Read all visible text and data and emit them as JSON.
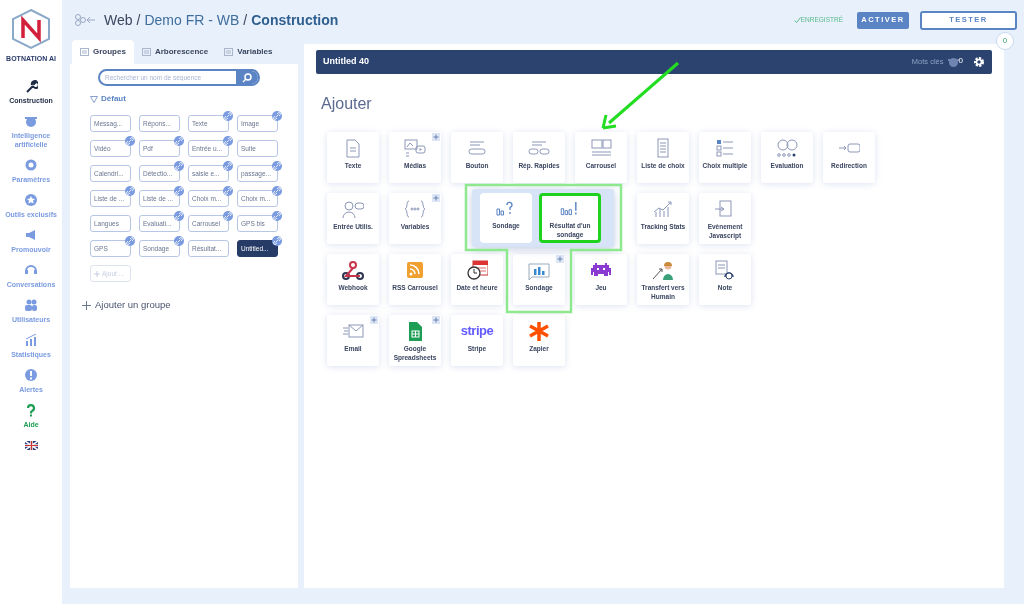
{
  "logo": {
    "text": "BOTNATION AI"
  },
  "nav": [
    {
      "label": "Construction",
      "color": "#1f2a44"
    },
    {
      "label": "Intelligence artificielle",
      "color": "#7b9be0"
    },
    {
      "label": "Paramètres",
      "color": "#7b9be0"
    },
    {
      "label": "Outils exclusifs",
      "color": "#7b9be0"
    },
    {
      "label": "Promouvoir",
      "color": "#7b9be0"
    },
    {
      "label": "Conversations",
      "color": "#7b9be0"
    },
    {
      "label": "Utilisateurs",
      "color": "#7b9be0"
    },
    {
      "label": "Statistiques",
      "color": "#7b9be0"
    },
    {
      "label": "Alertes",
      "color": "#7b9be0"
    },
    {
      "label": "Aide",
      "color": "#1e9e55"
    }
  ],
  "breadcrumb": [
    {
      "text": "Web",
      "kind": "root"
    },
    {
      "text": "/",
      "kind": "sep"
    },
    {
      "text": "Demo FR - WB",
      "kind": "link"
    },
    {
      "text": "/",
      "kind": "sep"
    },
    {
      "text": "Construction",
      "kind": "current"
    }
  ],
  "save_status": "ENREGISTRÉ",
  "buttons": [
    {
      "label": "ACTIVER",
      "kind": "primary"
    },
    {
      "label": "TESTER",
      "kind": "outline"
    }
  ],
  "notification_count": "0",
  "panel": {
    "tabs": [
      {
        "label": "Groupes",
        "selected": true
      },
      {
        "label": "Arborescence",
        "selected": false
      },
      {
        "label": "Variables",
        "selected": false
      }
    ],
    "search": {
      "placeholder": "Rechercher un nom de séquence"
    },
    "group": {
      "name": "Défaut",
      "expanded": true,
      "sequences": [
        {
          "label": "Messag...",
          "linked": false,
          "selected": false
        },
        {
          "label": "Répons...",
          "linked": false,
          "selected": false
        },
        {
          "label": "Texte",
          "linked": true,
          "selected": false
        },
        {
          "label": "Image",
          "linked": true,
          "selected": false
        },
        {
          "label": "Vidéo",
          "linked": true,
          "selected": false
        },
        {
          "label": "Pdf",
          "linked": true,
          "selected": false
        },
        {
          "label": "Entrée u...",
          "linked": true,
          "selected": false
        },
        {
          "label": "Suite",
          "linked": false,
          "selected": false
        },
        {
          "label": "Calendri...",
          "linked": false,
          "selected": false
        },
        {
          "label": "Détectio...",
          "linked": true,
          "selected": false
        },
        {
          "label": "saisie e...",
          "linked": true,
          "selected": false
        },
        {
          "label": "passage...",
          "linked": true,
          "selected": false
        },
        {
          "label": "Liste de ...",
          "linked": true,
          "selected": false
        },
        {
          "label": "Liste de ...",
          "linked": true,
          "selected": false
        },
        {
          "label": "Choix m...",
          "linked": true,
          "selected": false
        },
        {
          "label": "Choix m...",
          "linked": true,
          "selected": false
        },
        {
          "label": "Langues",
          "linked": false,
          "selected": false
        },
        {
          "label": "Evaluati...",
          "linked": true,
          "selected": false
        },
        {
          "label": "Carrousel",
          "linked": true,
          "selected": false
        },
        {
          "label": "GPS bis",
          "linked": true,
          "selected": false
        },
        {
          "label": "GPS",
          "linked": true,
          "selected": false
        },
        {
          "label": "Sondage",
          "linked": true,
          "selected": false
        },
        {
          "label": "Résultat...",
          "linked": false,
          "selected": false
        },
        {
          "label": "Untitled...",
          "linked": true,
          "selected": true
        }
      ],
      "add_label": "Ajout ..."
    },
    "add_group": "Ajouter un groupe"
  },
  "editor": {
    "title": "Untitled 40",
    "keywords": {
      "label": "Mots clés",
      "count": "0"
    },
    "heading": "Ajouter",
    "blocks": [
      {
        "kind": "tile",
        "label": "Texte",
        "expandable": false
      },
      {
        "kind": "tile",
        "label": "Médias",
        "expandable": true
      },
      {
        "kind": "tile",
        "label": "Bouton",
        "expandable": false
      },
      {
        "kind": "tile",
        "label": "Rép. Rapides",
        "expandable": false
      },
      {
        "kind": "tile",
        "label": "Carrousel",
        "expandable": false
      },
      {
        "kind": "tile",
        "label": "Liste de choix",
        "expandable": false
      },
      {
        "kind": "tile",
        "label": "Choix multiple",
        "expandable": false
      },
      {
        "kind": "tile",
        "label": "Evaluation",
        "expandable": false
      },
      {
        "kind": "tile",
        "label": "Redirection",
        "expandable": false
      },
      {
        "kind": "tile",
        "label": "Entrée Utilis.",
        "expandable": false
      },
      {
        "kind": "tile",
        "label": "Variables",
        "expandable": true
      },
      {
        "kind": "covered"
      },
      {
        "kind": "covered"
      },
      {
        "kind": "covered"
      },
      {
        "kind": "tile",
        "label": "Tracking Stats",
        "expandable": false
      },
      {
        "kind": "tile",
        "label": "Evènement Javascript",
        "expandable": false
      },
      {
        "kind": "break"
      },
      {
        "kind": "break"
      },
      {
        "kind": "tile",
        "label": "Webhook",
        "expandable": false
      },
      {
        "kind": "tile",
        "label": "RSS Carrousel",
        "expandable": false
      },
      {
        "kind": "tile",
        "label": "Date et heure",
        "expandable": false
      },
      {
        "kind": "tile",
        "label": "Sondage",
        "expandable": true
      },
      {
        "kind": "tile",
        "label": "Jeu",
        "expandable": false
      },
      {
        "kind": "tile",
        "label": "Transfert vers Humain",
        "expandable": false
      },
      {
        "kind": "tile",
        "label": "Note",
        "expandable": false
      },
      {
        "kind": "break"
      },
      {
        "kind": "break"
      },
      {
        "kind": "tile",
        "label": "Email",
        "expandable": true
      },
      {
        "kind": "tile",
        "label": "Google Spreadsheets",
        "expandable": true
      },
      {
        "kind": "logo",
        "label": "Stripe",
        "logo_text": "stripe",
        "expandable": false
      },
      {
        "kind": "tile",
        "label": "Zapier",
        "expandable": false
      }
    ],
    "popup": {
      "items": [
        {
          "label": "Sondage",
          "highlighted": false
        },
        {
          "label": "Résultat d'un sondage",
          "highlighted": true
        }
      ]
    }
  }
}
